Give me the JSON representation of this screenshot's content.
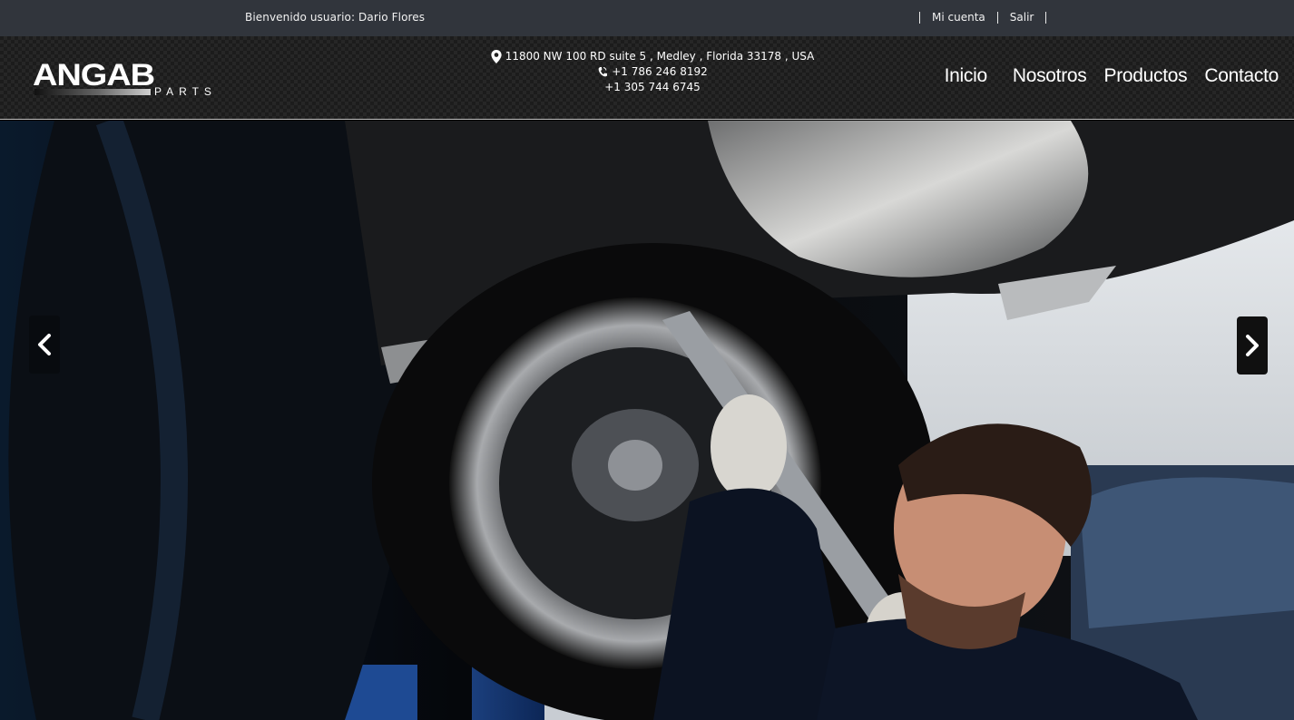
{
  "topbar": {
    "welcome": "Bienvenido usuario: Dario Flores",
    "links": [
      {
        "label": "Mi cuenta"
      },
      {
        "label": "Salir"
      }
    ]
  },
  "logo": {
    "main": "ANGAB",
    "sub": "PARTS"
  },
  "contact": {
    "address": "11800 NW 100 RD suite 5 , Medley , Florida 33178 , USA",
    "phone1": "+1 786 246 8192",
    "phone2": "+1 305 744 6745",
    "address_icon": "map-marker-icon",
    "phone_icon": "phone-icon"
  },
  "nav": {
    "items": [
      {
        "label": "Inicio"
      },
      {
        "label": "Nosotros"
      },
      {
        "label": "Productos"
      },
      {
        "label": "Contacto"
      }
    ]
  },
  "carousel": {
    "prev_icon": "chevron-left-icon",
    "next_icon": "chevron-right-icon"
  },
  "colors": {
    "topbar_bg": "#31353c",
    "header_bg": "#1c1c1c",
    "text": "#ffffff"
  }
}
